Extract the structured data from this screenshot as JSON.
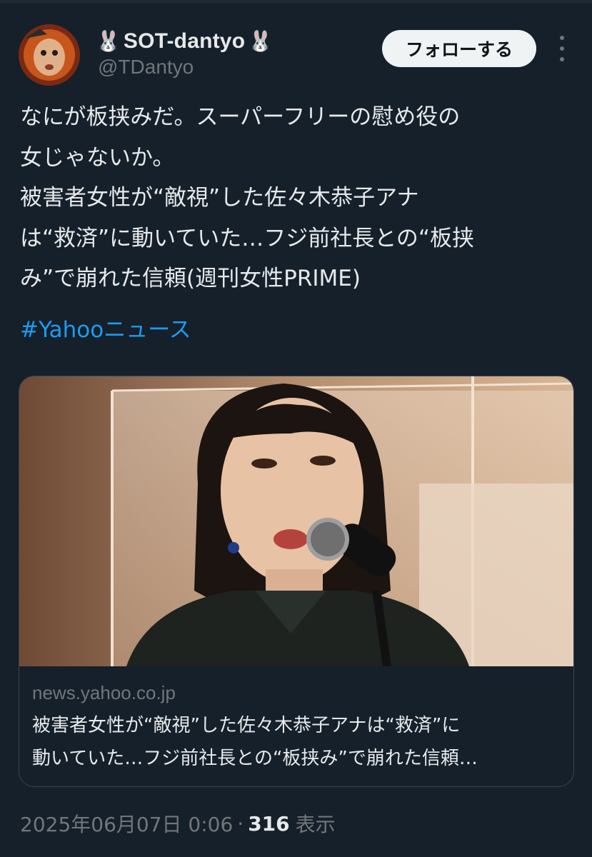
{
  "user": {
    "display_name": "SOT-dantyo",
    "name_emoji": "🐰",
    "handle": "@TDantyo"
  },
  "follow_button_label": "フォローする",
  "tweet": {
    "lines": [
      "なにが板挟みだ。スーパーフリーの慰め役の",
      "女じゃないか。",
      "被害者女性が“敵視”した佐々木恭子アナ",
      "は“救済”に動いていた…フジ前社長との“板挟",
      "み”で崩れた信頼(週刊女性PRIME)"
    ],
    "hashtag": "#Yahooニュース"
  },
  "card": {
    "domain": "news.yahoo.co.jp",
    "title_lines": [
      "被害者女性が“敵視”した佐々木恭子アナは“救済”に",
      "動いていた…フジ前社長との“板挟み”で崩れた信頼…"
    ]
  },
  "meta": {
    "timestamp": "2025年06月07日 0:06",
    "separator": "·",
    "views": "316",
    "views_label": "表示"
  },
  "colors": {
    "background": "#15202b",
    "text": "#e7e9ea",
    "secondary": "#71767b",
    "link": "#1d9bf0",
    "button_bg": "#eff3f4"
  }
}
